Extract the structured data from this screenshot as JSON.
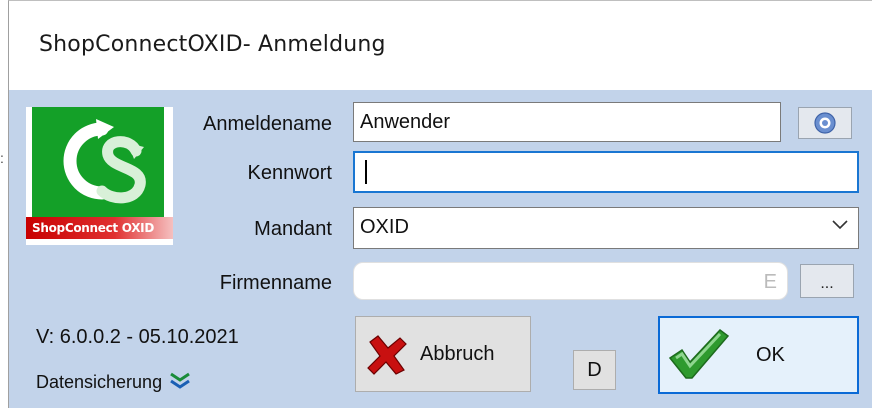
{
  "window": {
    "title": "ShopConnectOXID- Anmeldung"
  },
  "logo": {
    "text": "ShopConnect OXID"
  },
  "form": {
    "username_label": "Anmeldename",
    "username_value": "Anwender",
    "password_label": "Kennwort",
    "password_value": "",
    "client_label": "Mandant",
    "client_value": "OXID",
    "company_label": "Firmenname",
    "company_value": "",
    "company_truncated_char": "E",
    "company_more_label": "..."
  },
  "buttons": {
    "cancel_label": "Abbruch",
    "d_label": "D",
    "ok_label": "OK"
  },
  "footer": {
    "version": "V: 6.0.0.2 - 05.10.2021",
    "backup_label": "Datensicherung"
  }
}
